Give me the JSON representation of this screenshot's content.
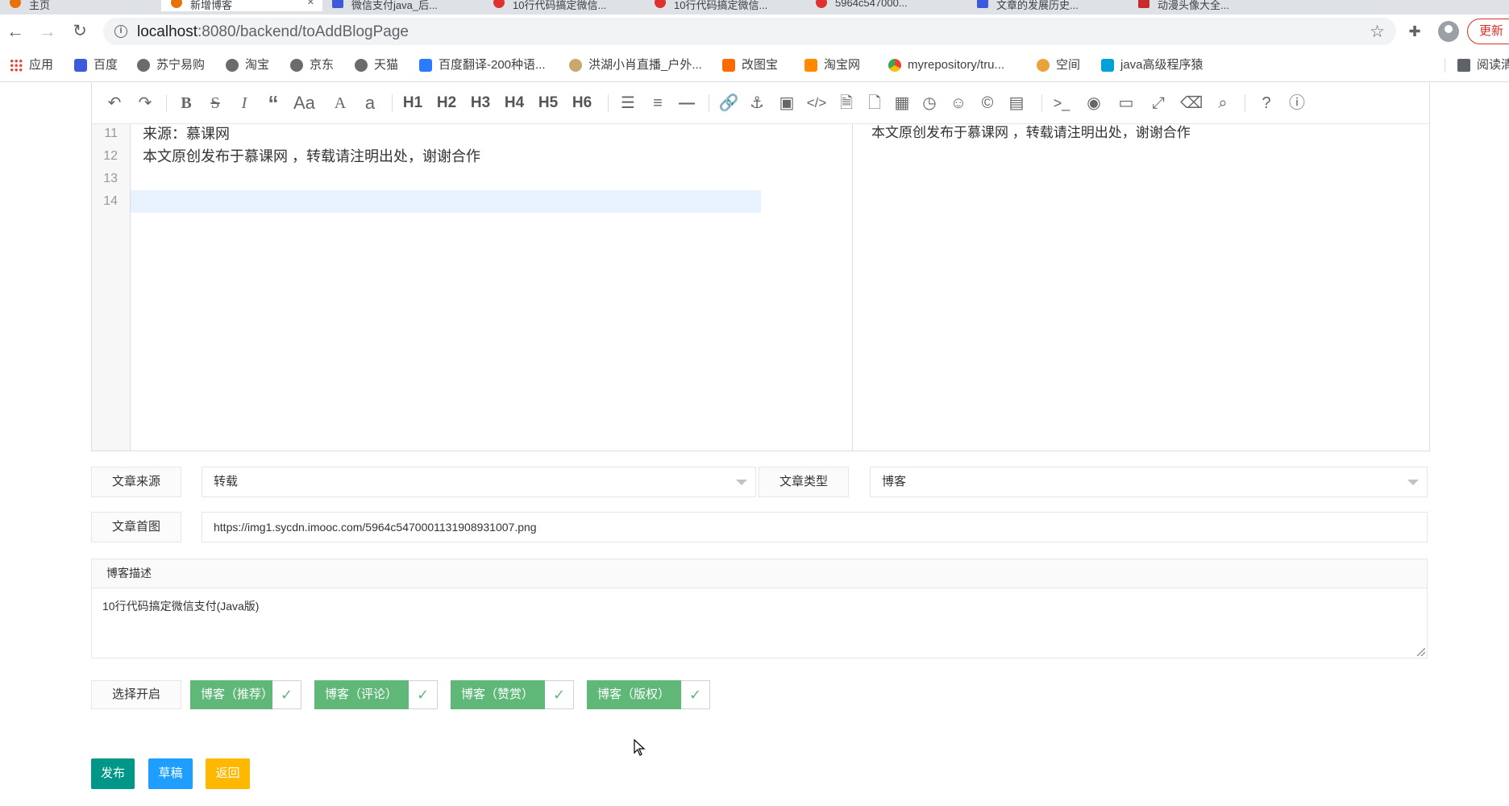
{
  "browser": {
    "tabs": [
      {
        "title": "主页"
      },
      {
        "title": "新增博客"
      },
      {
        "title": "微信支付java_后..."
      },
      {
        "title": "10行代码搞定微信..."
      },
      {
        "title": "10行代码搞定微信..."
      },
      {
        "title": "5964c547000..."
      },
      {
        "title": "文章的发展历史..."
      },
      {
        "title": "动漫头像大全..."
      }
    ],
    "url_host": "localhost",
    "url_path": ":8080/backend/toAddBlogPage",
    "update_label": "更新"
  },
  "bookmarks": [
    {
      "label": "应用",
      "icon": "apps-grid-icon"
    },
    {
      "label": "百度",
      "icon": "baidu-icon"
    },
    {
      "label": "苏宁易购",
      "icon": "globe-icon"
    },
    {
      "label": "淘宝",
      "icon": "globe-icon"
    },
    {
      "label": "京东",
      "icon": "globe-icon"
    },
    {
      "label": "天猫",
      "icon": "globe-icon"
    },
    {
      "label": "百度翻译-200种语...",
      "icon": "translate-icon"
    },
    {
      "label": "洪湖小肖直播_户外...",
      "icon": "live-icon"
    },
    {
      "label": "改图宝",
      "icon": "image-tool-icon"
    },
    {
      "label": "淘宝网",
      "icon": "taobao-icon"
    },
    {
      "label": "myrepository/tru...",
      "icon": "chrome-icon"
    },
    {
      "label": "空间",
      "icon": "qzone-icon"
    },
    {
      "label": "java高级程序猿",
      "icon": "bilibili-icon"
    },
    {
      "label": "阅读清",
      "icon": "reading-list-icon"
    }
  ],
  "editor": {
    "lines": [
      {
        "num": "11",
        "text": "来源：慕课网"
      },
      {
        "num": "12",
        "text": "本文原创发布于慕课网 ，转载请注明出处，谢谢合作"
      },
      {
        "num": "13",
        "text": ""
      },
      {
        "num": "14",
        "text": ""
      }
    ],
    "preview_text": "本文原创发布于慕课网 ，转载请注明出处，谢谢合作"
  },
  "toolbar": {
    "headings": [
      "H1",
      "H2",
      "H3",
      "H4",
      "H5",
      "H6"
    ],
    "text_case": "Aa",
    "upper": "A",
    "lower": "a"
  },
  "form": {
    "source_label": "文章来源",
    "source_value": "转载",
    "type_label": "文章类型",
    "type_value": "博客",
    "cover_label": "文章首图",
    "cover_value": "https://img1.sycdn.imooc.com/5964c5470001131908931007.png",
    "desc_title": "博客描述",
    "desc_value": "10行代码搞定微信支付(Java版)",
    "toggle_label": "选择开启",
    "toggles": [
      {
        "label": "博客（推荐）",
        "checked": true
      },
      {
        "label": "博客（评论）",
        "checked": true
      },
      {
        "label": "博客（赞赏）",
        "checked": true
      },
      {
        "label": "博客（版权）",
        "checked": true
      }
    ]
  },
  "actions": {
    "publish": "发布",
    "draft": "草稿",
    "back": "返回"
  },
  "colors": {
    "switch_green": "#5fb878",
    "publish_bg": "#009688",
    "draft_bg": "#1e9fff",
    "back_bg": "#ffb800",
    "active_line": "#e8f2fe"
  }
}
